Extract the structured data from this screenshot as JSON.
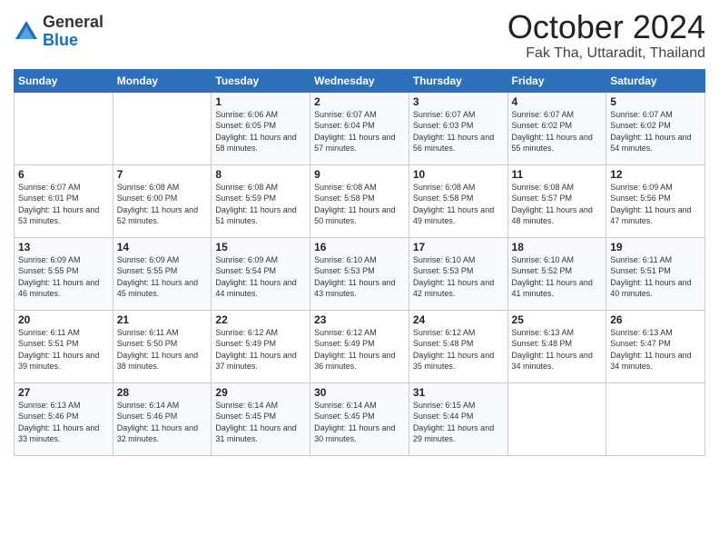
{
  "logo": {
    "general": "General",
    "blue": "Blue"
  },
  "title": "October 2024",
  "location": "Fak Tha, Uttaradit, Thailand",
  "days_of_week": [
    "Sunday",
    "Monday",
    "Tuesday",
    "Wednesday",
    "Thursday",
    "Friday",
    "Saturday"
  ],
  "weeks": [
    [
      {
        "day": "",
        "info": ""
      },
      {
        "day": "",
        "info": ""
      },
      {
        "day": "1",
        "info": "Sunrise: 6:06 AM\nSunset: 6:05 PM\nDaylight: 11 hours and 58 minutes."
      },
      {
        "day": "2",
        "info": "Sunrise: 6:07 AM\nSunset: 6:04 PM\nDaylight: 11 hours and 57 minutes."
      },
      {
        "day": "3",
        "info": "Sunrise: 6:07 AM\nSunset: 6:03 PM\nDaylight: 11 hours and 56 minutes."
      },
      {
        "day": "4",
        "info": "Sunrise: 6:07 AM\nSunset: 6:02 PM\nDaylight: 11 hours and 55 minutes."
      },
      {
        "day": "5",
        "info": "Sunrise: 6:07 AM\nSunset: 6:02 PM\nDaylight: 11 hours and 54 minutes."
      }
    ],
    [
      {
        "day": "6",
        "info": "Sunrise: 6:07 AM\nSunset: 6:01 PM\nDaylight: 11 hours and 53 minutes."
      },
      {
        "day": "7",
        "info": "Sunrise: 6:08 AM\nSunset: 6:00 PM\nDaylight: 11 hours and 52 minutes."
      },
      {
        "day": "8",
        "info": "Sunrise: 6:08 AM\nSunset: 5:59 PM\nDaylight: 11 hours and 51 minutes."
      },
      {
        "day": "9",
        "info": "Sunrise: 6:08 AM\nSunset: 5:58 PM\nDaylight: 11 hours and 50 minutes."
      },
      {
        "day": "10",
        "info": "Sunrise: 6:08 AM\nSunset: 5:58 PM\nDaylight: 11 hours and 49 minutes."
      },
      {
        "day": "11",
        "info": "Sunrise: 6:08 AM\nSunset: 5:57 PM\nDaylight: 11 hours and 48 minutes."
      },
      {
        "day": "12",
        "info": "Sunrise: 6:09 AM\nSunset: 5:56 PM\nDaylight: 11 hours and 47 minutes."
      }
    ],
    [
      {
        "day": "13",
        "info": "Sunrise: 6:09 AM\nSunset: 5:55 PM\nDaylight: 11 hours and 46 minutes."
      },
      {
        "day": "14",
        "info": "Sunrise: 6:09 AM\nSunset: 5:55 PM\nDaylight: 11 hours and 45 minutes."
      },
      {
        "day": "15",
        "info": "Sunrise: 6:09 AM\nSunset: 5:54 PM\nDaylight: 11 hours and 44 minutes."
      },
      {
        "day": "16",
        "info": "Sunrise: 6:10 AM\nSunset: 5:53 PM\nDaylight: 11 hours and 43 minutes."
      },
      {
        "day": "17",
        "info": "Sunrise: 6:10 AM\nSunset: 5:53 PM\nDaylight: 11 hours and 42 minutes."
      },
      {
        "day": "18",
        "info": "Sunrise: 6:10 AM\nSunset: 5:52 PM\nDaylight: 11 hours and 41 minutes."
      },
      {
        "day": "19",
        "info": "Sunrise: 6:11 AM\nSunset: 5:51 PM\nDaylight: 11 hours and 40 minutes."
      }
    ],
    [
      {
        "day": "20",
        "info": "Sunrise: 6:11 AM\nSunset: 5:51 PM\nDaylight: 11 hours and 39 minutes."
      },
      {
        "day": "21",
        "info": "Sunrise: 6:11 AM\nSunset: 5:50 PM\nDaylight: 11 hours and 38 minutes."
      },
      {
        "day": "22",
        "info": "Sunrise: 6:12 AM\nSunset: 5:49 PM\nDaylight: 11 hours and 37 minutes."
      },
      {
        "day": "23",
        "info": "Sunrise: 6:12 AM\nSunset: 5:49 PM\nDaylight: 11 hours and 36 minutes."
      },
      {
        "day": "24",
        "info": "Sunrise: 6:12 AM\nSunset: 5:48 PM\nDaylight: 11 hours and 35 minutes."
      },
      {
        "day": "25",
        "info": "Sunrise: 6:13 AM\nSunset: 5:48 PM\nDaylight: 11 hours and 34 minutes."
      },
      {
        "day": "26",
        "info": "Sunrise: 6:13 AM\nSunset: 5:47 PM\nDaylight: 11 hours and 34 minutes."
      }
    ],
    [
      {
        "day": "27",
        "info": "Sunrise: 6:13 AM\nSunset: 5:46 PM\nDaylight: 11 hours and 33 minutes."
      },
      {
        "day": "28",
        "info": "Sunrise: 6:14 AM\nSunset: 5:46 PM\nDaylight: 11 hours and 32 minutes."
      },
      {
        "day": "29",
        "info": "Sunrise: 6:14 AM\nSunset: 5:45 PM\nDaylight: 11 hours and 31 minutes."
      },
      {
        "day": "30",
        "info": "Sunrise: 6:14 AM\nSunset: 5:45 PM\nDaylight: 11 hours and 30 minutes."
      },
      {
        "day": "31",
        "info": "Sunrise: 6:15 AM\nSunset: 5:44 PM\nDaylight: 11 hours and 29 minutes."
      },
      {
        "day": "",
        "info": ""
      },
      {
        "day": "",
        "info": ""
      }
    ]
  ]
}
